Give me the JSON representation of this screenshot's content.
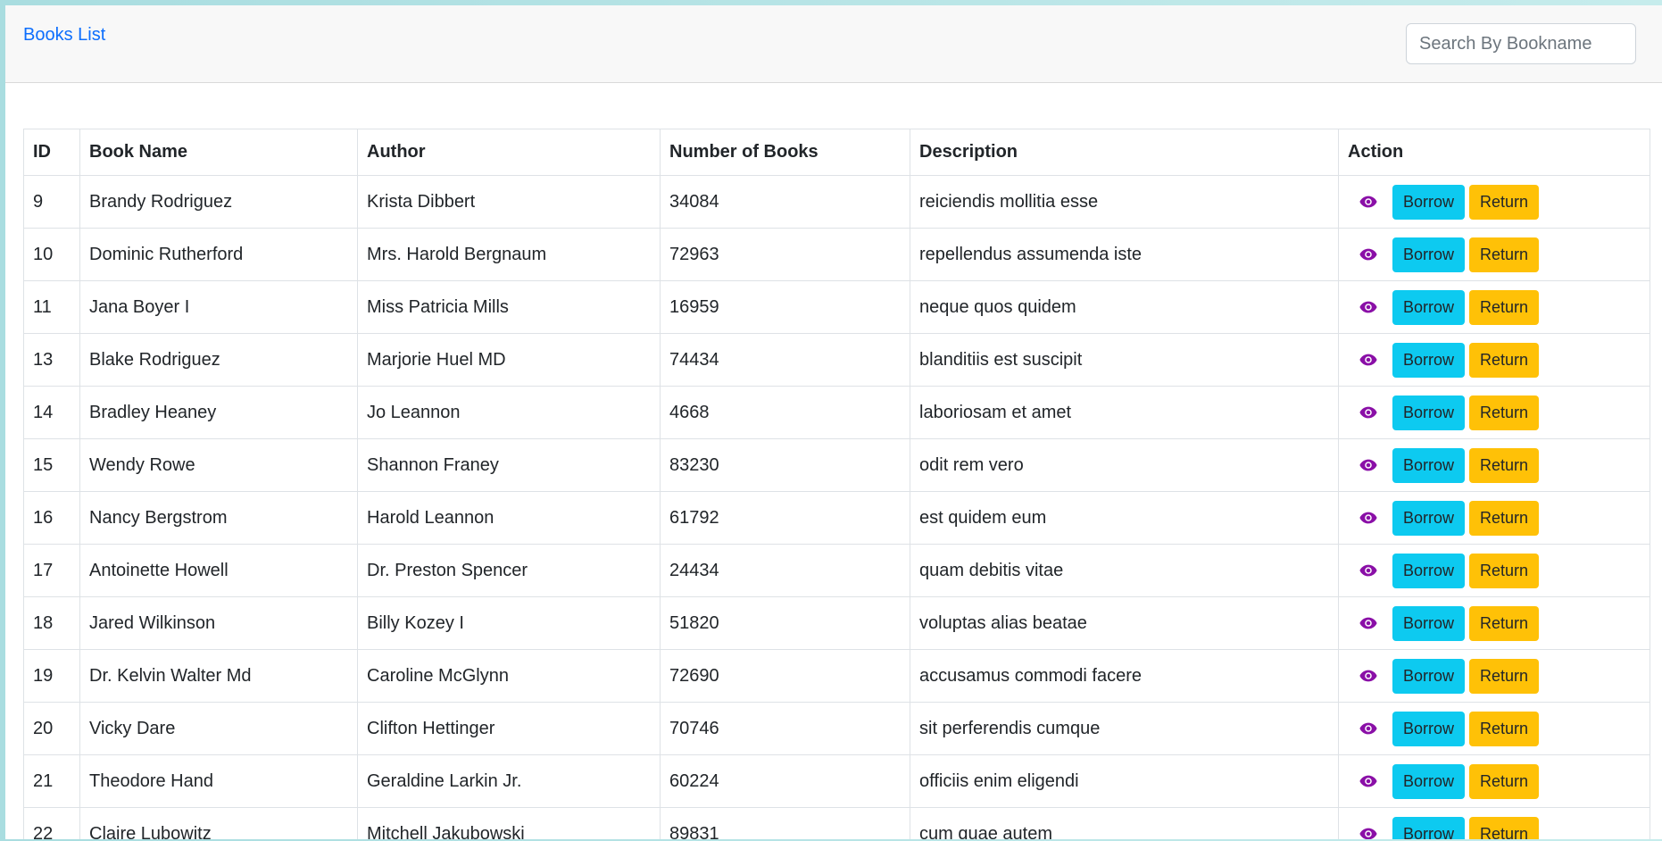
{
  "navbar": {
    "brand": "Books List",
    "search_placeholder": "Search By Bookname"
  },
  "table": {
    "headers": [
      "ID",
      "Book Name",
      "Author",
      "Number of Books",
      "Description",
      "Action"
    ],
    "rows": [
      {
        "id": "9",
        "name": "Brandy Rodriguez",
        "author": "Krista Dibbert",
        "count": "34084",
        "description": "reiciendis mollitia esse"
      },
      {
        "id": "10",
        "name": "Dominic Rutherford",
        "author": "Mrs. Harold Bergnaum",
        "count": "72963",
        "description": "repellendus assumenda iste"
      },
      {
        "id": "11",
        "name": "Jana Boyer I",
        "author": "Miss Patricia Mills",
        "count": "16959",
        "description": "neque quos quidem"
      },
      {
        "id": "13",
        "name": "Blake Rodriguez",
        "author": "Marjorie Huel MD",
        "count": "74434",
        "description": "blanditiis est suscipit"
      },
      {
        "id": "14",
        "name": "Bradley Heaney",
        "author": "Jo Leannon",
        "count": "4668",
        "description": "laboriosam et amet"
      },
      {
        "id": "15",
        "name": "Wendy Rowe",
        "author": "Shannon Franey",
        "count": "83230",
        "description": "odit rem vero"
      },
      {
        "id": "16",
        "name": "Nancy Bergstrom",
        "author": "Harold Leannon",
        "count": "61792",
        "description": "est quidem eum"
      },
      {
        "id": "17",
        "name": "Antoinette Howell",
        "author": "Dr. Preston Spencer",
        "count": "24434",
        "description": "quam debitis vitae"
      },
      {
        "id": "18",
        "name": "Jared Wilkinson",
        "author": "Billy Kozey I",
        "count": "51820",
        "description": "voluptas alias beatae"
      },
      {
        "id": "19",
        "name": "Dr. Kelvin Walter Md",
        "author": "Caroline McGlynn",
        "count": "72690",
        "description": "accusamus commodi facere"
      },
      {
        "id": "20",
        "name": "Vicky Dare",
        "author": "Clifton Hettinger",
        "count": "70746",
        "description": "sit perferendis cumque"
      },
      {
        "id": "21",
        "name": "Theodore Hand",
        "author": "Geraldine Larkin Jr.",
        "count": "60224",
        "description": "officiis enim eligendi"
      },
      {
        "id": "22",
        "name": "Claire Lubowitz",
        "author": "Mitchell Jakubowski",
        "count": "89831",
        "description": "cum quae autem"
      }
    ],
    "actions": {
      "view_icon": "eye-icon",
      "borrow_label": "Borrow",
      "return_label": "Return"
    }
  },
  "colors": {
    "brand_link": "#0d6efd",
    "eye_icon": "#8a0fa7",
    "borrow_button": "#0dcaf0",
    "return_button": "#ffc107"
  }
}
